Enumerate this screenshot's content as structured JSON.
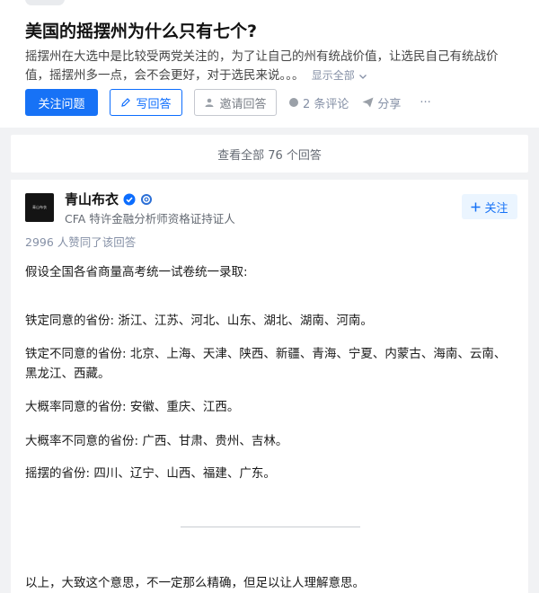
{
  "question": {
    "title": "美国的摇摆州为什么只有七个?",
    "description": "摇摆州在大选中是比较受两党关注的，为了让自己的州有统战价值，让选民自己有统战价值，摇摆州多一点，会不会更好，对于选民来说。。。",
    "show_all": "显示全部"
  },
  "actions": {
    "follow_question": "关注问题",
    "write_answer": "写回答",
    "invite_answer": "邀请回答",
    "comments": "2 条评论",
    "share": "分享",
    "more": "···"
  },
  "view_all_answers": "查看全部 76 个回答",
  "answer": {
    "author_name": "青山布衣",
    "avatar_text": "青山布衣",
    "author_bio": "CFA 特许金融分析师资格证持证人",
    "follow_label": "关注",
    "votes_text": "2996 人赞同了该回答",
    "paragraphs": [
      "假设全国各省商量高考统一试卷统一录取:",
      "铁定同意的省份: 浙江、江苏、河北、山东、湖北、湖南、河南。",
      "铁定不同意的省份: 北京、上海、天津、陕西、新疆、青海、宁夏、内蒙古、海南、云南、黑龙江、西藏。",
      "大概率同意的省份: 安徽、重庆、江西。",
      "大概率不同意的省份: 广西、甘肃、贵州、吉林。",
      "摇摆的省份: 四川、辽宁、山西、福建、广东。",
      "以上，大致这个意思，不一定那么精确，但足以让人理解意思。"
    ]
  },
  "colors": {
    "primary": "#1772f6",
    "verified": "#0c6dfe",
    "muted": "#8590a6"
  }
}
